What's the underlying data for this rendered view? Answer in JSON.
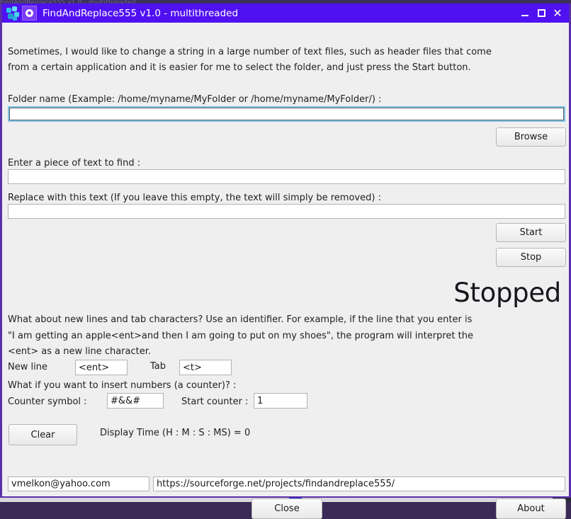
{
  "background": {
    "occluded_window_title": "FindAndReplace555 v1.0 - multithreaded"
  },
  "window": {
    "title": "FindAndReplace555 v1.0 - multithreaded",
    "icons": {
      "app_icon": "blocks-icon",
      "doc_icon": "ring-icon"
    },
    "controls": {
      "minimize": "minimize-icon",
      "maximize": "maximize-icon",
      "close": "close-icon"
    },
    "title_bar_color": "#5011f2",
    "border_color": "#5a2fa8",
    "background_color": "#efeff0"
  },
  "intro": {
    "line1": "Sometimes, I would like to change a string in a large number of text files, such as header files that come",
    "line2": "from a certain application and it is easier for me to select the folder, and just press the Start button."
  },
  "folder": {
    "label": "Folder name (Example: /home/myname/MyFolder or /home/myname/MyFolder/) :",
    "value": "",
    "placeholder": "",
    "browse_label": "Browse"
  },
  "find": {
    "label": "Enter a piece of text to find :",
    "value": "",
    "placeholder": ""
  },
  "replace": {
    "label": "Replace with this text (If you leave this empty, the text will simply be removed) :",
    "value": "",
    "placeholder": ""
  },
  "actions": {
    "start_label": "Start",
    "stop_label": "Stop",
    "status": "Stopped"
  },
  "identifiers": {
    "para_line1": "What about new lines and tab characters? Use an identifier. For example, if the line that you enter is",
    "para_line2": "\"I am getting an apple<ent>and then I am going to put on my shoes\", the program will interpret the",
    "para_line3": "<ent> as a new line character.",
    "newline_label": "New line",
    "newline_value": "<ent>",
    "tab_label": "Tab",
    "tab_value": "<t>"
  },
  "counter": {
    "question": "What if you want to insert numbers (a counter)? :",
    "symbol_label": "Counter symbol :",
    "symbol_value": "#&&#",
    "start_label": "Start counter :",
    "start_value": "1"
  },
  "footer_tools": {
    "clear_label": "Clear",
    "display_time": "Display Time (H : M : S : MS) = 0"
  },
  "contact": {
    "email": "vmelkon@yahoo.com",
    "url": "https://sourceforge.net/projects/findandreplace555/"
  },
  "bottom_buttons": {
    "close_label": "Close",
    "about_label": "About"
  }
}
